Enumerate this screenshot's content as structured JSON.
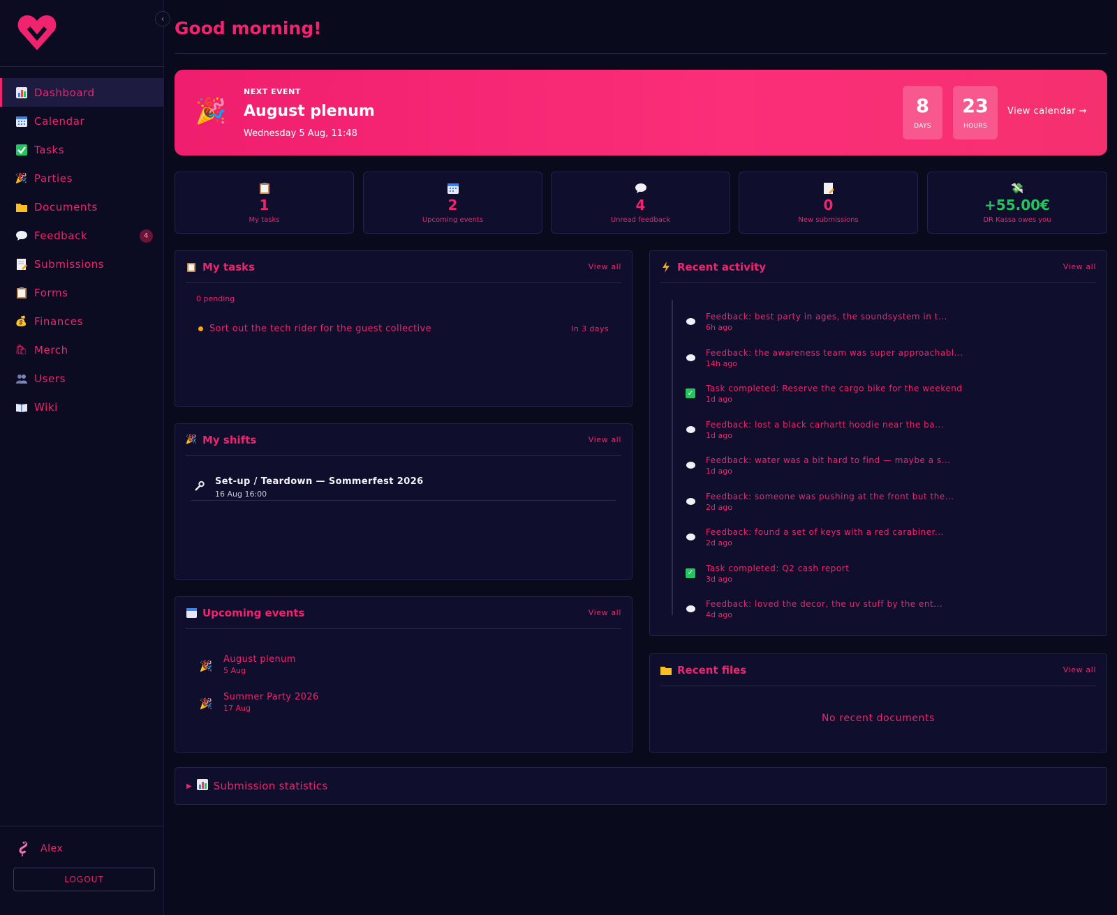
{
  "sidebar": {
    "items": [
      {
        "label": "Dashboard",
        "icon": "bar-chart-icon"
      },
      {
        "label": "Calendar",
        "icon": "calendar-icon"
      },
      {
        "label": "Tasks",
        "icon": "checkbox-icon"
      },
      {
        "label": "Parties",
        "icon": "party-popper-icon"
      },
      {
        "label": "Documents",
        "icon": "folder-icon"
      },
      {
        "label": "Feedback",
        "icon": "speech-bubble-icon",
        "badge": "4"
      },
      {
        "label": "Submissions",
        "icon": "document-pencil-icon"
      },
      {
        "label": "Forms",
        "icon": "clipboard-icon"
      },
      {
        "label": "Finances",
        "icon": "money-bag-icon"
      },
      {
        "label": "Merch",
        "icon": "shopping-bags-icon"
      },
      {
        "label": "Users",
        "icon": "users-icon"
      },
      {
        "label": "Wiki",
        "icon": "book-icon"
      }
    ],
    "user": "Alex",
    "logout": "LOGOUT"
  },
  "greeting": "Good morning!",
  "hero": {
    "label": "NEXT EVENT",
    "title": "August plenum",
    "date": "Wednesday 5 Aug, 11:48",
    "days": "8",
    "days_label": "DAYS",
    "hours": "23",
    "hours_label": "HOURS",
    "link": "View calendar →"
  },
  "stats": [
    {
      "value": "1",
      "label": "My tasks"
    },
    {
      "value": "2",
      "label": "Upcoming events"
    },
    {
      "value": "4",
      "label": "Unread feedback"
    },
    {
      "value": "0",
      "label": "New submissions"
    },
    {
      "value": "+55.00€",
      "label": "DR Kassa owes you"
    }
  ],
  "tasks": {
    "title": "My tasks",
    "view_all": "View all",
    "pending": "0 pending",
    "item": "Sort out the tech rider for the guest collective",
    "due": "In 3 days"
  },
  "shifts": {
    "title": "My shifts",
    "view_all": "View all",
    "item": "Set-up / Teardown — Sommerfest 2026",
    "date": "16 Aug 16:00"
  },
  "events": {
    "title": "Upcoming events",
    "view_all": "View all",
    "items": [
      {
        "title": "August plenum",
        "date": "5 Aug"
      },
      {
        "title": "Summer Party 2026",
        "date": "17 Aug"
      }
    ]
  },
  "activity": {
    "title": "Recent activity",
    "view_all": "View all",
    "items": [
      {
        "type": "feedback",
        "text": "Feedback: best party in ages, the soundsystem in t...",
        "time": "6h ago"
      },
      {
        "type": "feedback",
        "text": "Feedback: the awareness team was super approachabl...",
        "time": "14h ago"
      },
      {
        "type": "task",
        "text": "Task completed: Reserve the cargo bike for the weekend",
        "time": "1d ago"
      },
      {
        "type": "feedback",
        "text": "Feedback: lost a black carhartt hoodie near the ba...",
        "time": "1d ago"
      },
      {
        "type": "feedback",
        "text": "Feedback: water was a bit hard to find — maybe a s...",
        "time": "1d ago"
      },
      {
        "type": "feedback",
        "text": "Feedback: someone was pushing at the front but the...",
        "time": "2d ago"
      },
      {
        "type": "feedback",
        "text": "Feedback: found a set of keys with a red carabiner...",
        "time": "2d ago"
      },
      {
        "type": "task",
        "text": "Task completed: Q2 cash report",
        "time": "3d ago"
      },
      {
        "type": "feedback",
        "text": "Feedback: loved the decor, the uv stuff by the ent...",
        "time": "4d ago"
      }
    ]
  },
  "files": {
    "title": "Recent files",
    "view_all": "View all",
    "empty": "No recent documents"
  },
  "submission_stats": {
    "title": "Submission statistics"
  },
  "colors": {
    "accent": "#f0246e",
    "background": "#0a0a1d",
    "panel": "#0f0e2c",
    "positive": "#22c55e"
  }
}
